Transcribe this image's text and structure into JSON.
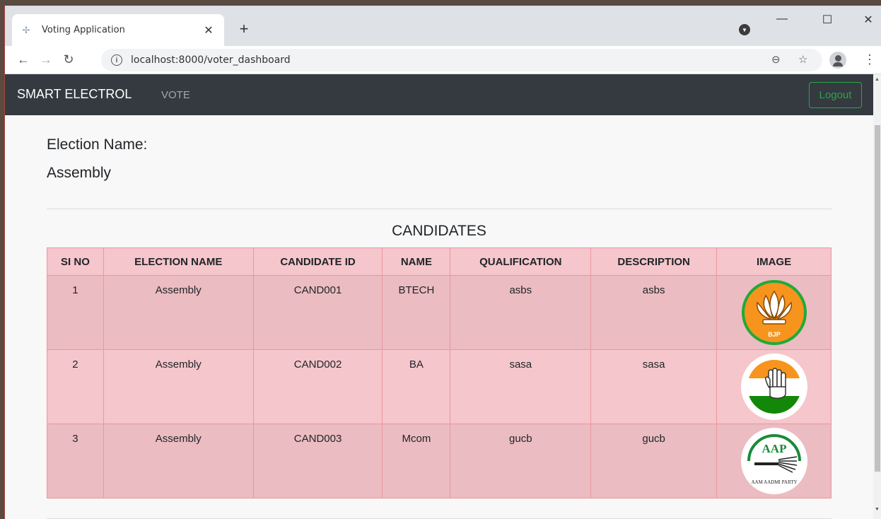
{
  "browser": {
    "tab_title": "Voting Application",
    "url": "localhost:8000/voter_dashboard"
  },
  "nav": {
    "brand": "SMART ELECTROL",
    "link": "VOTE",
    "logout": "Logout"
  },
  "election": {
    "label": "Election Name:",
    "name": "Assembly"
  },
  "candidates": {
    "title": "CANDIDATES",
    "headers": [
      "SI NO",
      "ELECTION NAME",
      "CANDIDATE ID",
      "NAME",
      "QUALIFICATION",
      "DESCRIPTION",
      "IMAGE"
    ],
    "rows": [
      {
        "si": "1",
        "election": "Assembly",
        "id": "CAND001",
        "name": "BTECH",
        "qualification": "asbs",
        "description": "asbs",
        "image": "bjp-lotus-logo",
        "image_text": "BJP"
      },
      {
        "si": "2",
        "election": "Assembly",
        "id": "CAND002",
        "name": "BA",
        "qualification": "sasa",
        "description": "sasa",
        "image": "congress-hand-logo"
      },
      {
        "si": "3",
        "election": "Assembly",
        "id": "CAND003",
        "name": "Mcom",
        "qualification": "gucb",
        "description": "gucb",
        "image": "aap-broom-logo",
        "image_text": "AAP",
        "image_subtext": "AAM AADMI PARTY"
      }
    ]
  },
  "colors": {
    "navbar": "#343a40",
    "logout_accent": "#28a745",
    "table_header": "#f5c6cb",
    "table_border": "#ed969e"
  }
}
